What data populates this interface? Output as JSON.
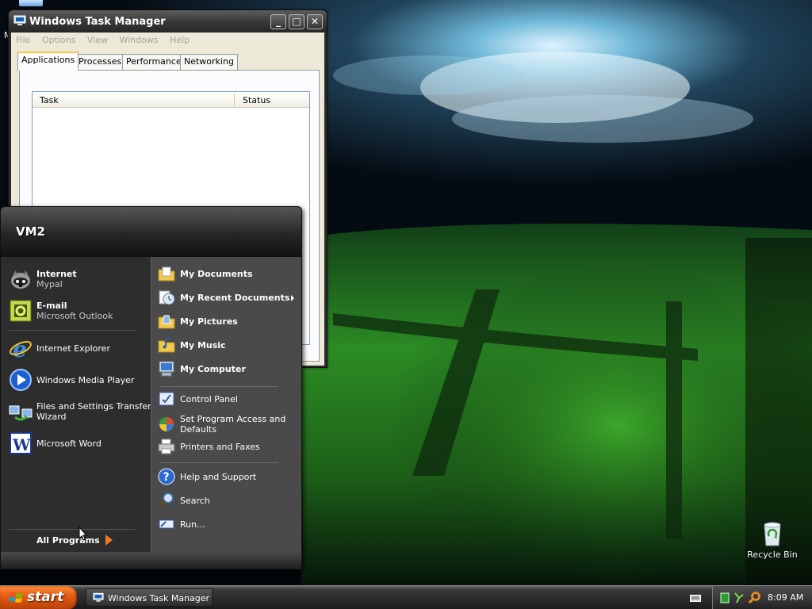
{
  "desktop": {
    "recycle_bin_label": "Recycle Bin",
    "partial_icon_label": "M"
  },
  "task_manager": {
    "title": "Windows Task Manager",
    "window_buttons": {
      "minimize": "_",
      "maximize": "□",
      "close": "✕"
    },
    "menu": [
      "File",
      "Options",
      "View",
      "Windows",
      "Help"
    ],
    "tabs": [
      {
        "label": "Applications",
        "active": true
      },
      {
        "label": "Processes",
        "active": false
      },
      {
        "label": "Performance",
        "active": false
      },
      {
        "label": "Networking",
        "active": false
      }
    ],
    "columns": {
      "task": "Task",
      "status": "Status"
    },
    "rows": []
  },
  "start_menu": {
    "user": "VM2",
    "pinned": [
      {
        "title": "Internet",
        "subtitle": "Mypal",
        "icon": "mypal-icon"
      },
      {
        "title": "E-mail",
        "subtitle": "Microsoft Outlook",
        "icon": "outlook-icon"
      }
    ],
    "recent": [
      {
        "label": "Internet Explorer",
        "icon": "internet-explorer-icon"
      },
      {
        "label": "Windows Media Player",
        "icon": "media-player-icon"
      },
      {
        "label": "Files and Settings Transfer",
        "label2": "Wizard",
        "icon": "transfer-wizard-icon"
      },
      {
        "label": "Microsoft Word",
        "icon": "word-icon"
      }
    ],
    "all_programs": "All Programs",
    "places": [
      {
        "label": "My Documents",
        "icon": "documents-folder-icon"
      },
      {
        "label": "My Recent Documents",
        "icon": "recent-documents-icon",
        "submenu": true
      },
      {
        "label": "My Pictures",
        "icon": "pictures-folder-icon"
      },
      {
        "label": "My Music",
        "icon": "music-folder-icon"
      },
      {
        "label": "My Computer",
        "icon": "computer-icon"
      }
    ],
    "settings": [
      {
        "label": "Control Panel",
        "icon": "control-panel-icon"
      },
      {
        "label": "Set Program Access and",
        "label2": "Defaults",
        "icon": "program-access-icon"
      },
      {
        "label": "Printers and Faxes",
        "icon": "printer-icon"
      }
    ],
    "system": [
      {
        "label": "Help and Support",
        "icon": "help-icon"
      },
      {
        "label": "Search",
        "icon": "search-icon"
      },
      {
        "label": "Run...",
        "icon": "run-icon"
      }
    ]
  },
  "taskbar": {
    "start_label": "start",
    "tasks": [
      {
        "label": "Windows Task Manager",
        "icon": "task-manager-icon"
      }
    ],
    "clock": "8:09 AM"
  },
  "colors": {
    "start_button": "#e25a10",
    "menu_dark": "#2d2d2d",
    "menu_light": "#4a4a4a",
    "active_tab_accent": "#ffc83c"
  }
}
